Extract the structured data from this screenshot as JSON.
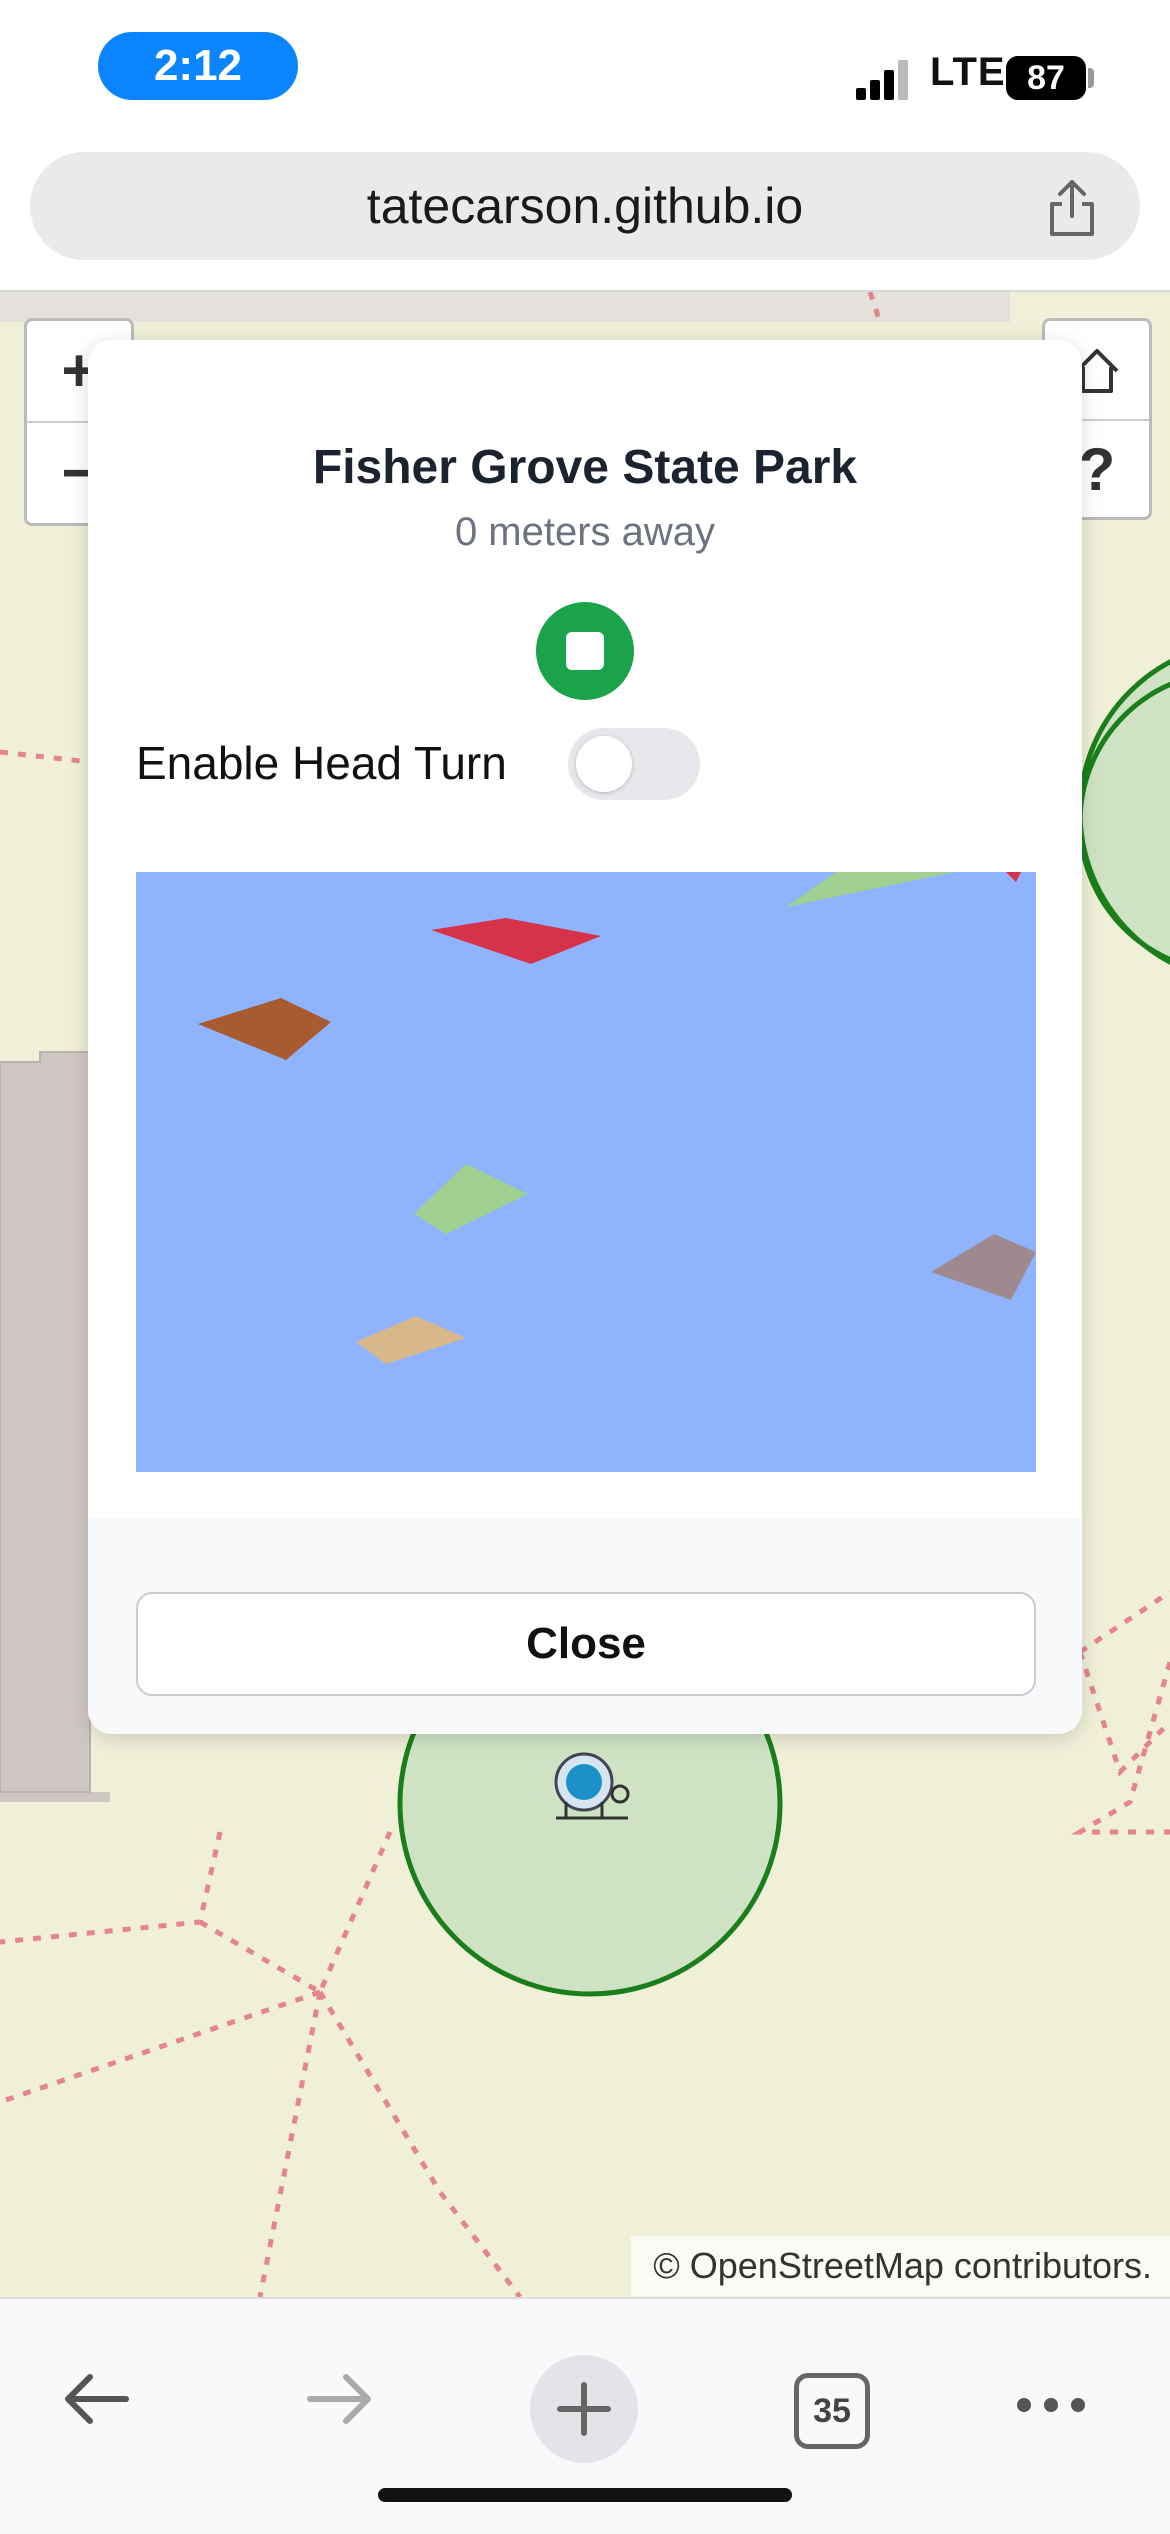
{
  "status_bar": {
    "time": "2:12",
    "network": "LTE",
    "battery": "87"
  },
  "browser": {
    "url": "tatecarson.github.io",
    "tab_count": "35"
  },
  "map": {
    "zoom_in": "+",
    "zoom_out": "−",
    "help": "?",
    "attribution": "© OpenStreetMap contributors."
  },
  "modal": {
    "title": "Fisher Grove State Park",
    "distance": "0 meters away",
    "head_turn_label": "Enable Head Turn",
    "head_turn_enabled": false,
    "close_label": "Close"
  },
  "colors": {
    "accent": "#0a84ff",
    "play_stop": "#1aa34a",
    "scene_background": "#8fb4fd",
    "map_background": "#f0efd8",
    "circle_fill": "#cfe3c4",
    "circle_stroke": "#1a7f1a"
  }
}
